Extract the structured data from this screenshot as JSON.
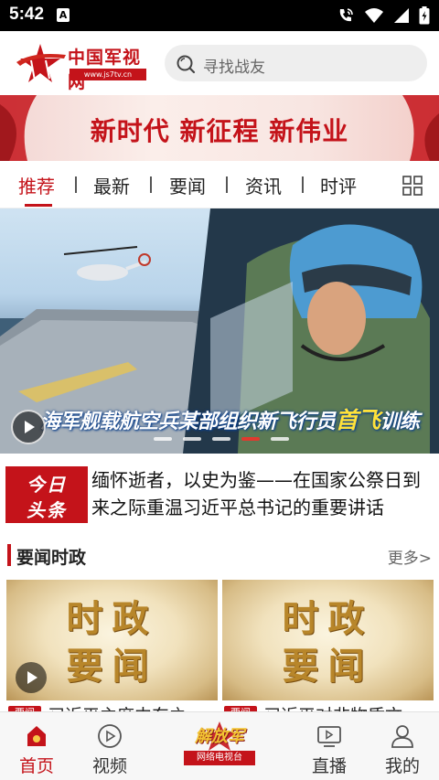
{
  "status_bar": {
    "time": "5:42",
    "notification": "A"
  },
  "header": {
    "logo_name": "中国军视网",
    "logo_url": "www.js7tv.cn",
    "search_placeholder": "寻找战友"
  },
  "banner": {
    "slogan": "新时代 新征程 新伟业"
  },
  "tabs": [
    {
      "label": "推荐",
      "active": true
    },
    {
      "label": "最新",
      "active": false
    },
    {
      "label": "要闻",
      "active": false
    },
    {
      "label": "资讯",
      "active": false
    },
    {
      "label": "时评",
      "active": false
    }
  ],
  "hero": {
    "caption_main": "海军舰载航空兵某部组织新飞行员",
    "caption_highlight": "首飞",
    "caption_end": "训练",
    "slide_count": 5,
    "active_slide": 4
  },
  "headline": {
    "badge_line1": "今日",
    "badge_line2": "头条",
    "text": "缅怀逝者，以史为鉴——在国家公祭日到来之际重温习近平总书记的重要讲话"
  },
  "section": {
    "title": "要闻时政",
    "more": "更多>"
  },
  "cards": [
    {
      "line1": "时政",
      "line2": "要闻",
      "tag": "要闻",
      "title": "习近平主席中东之"
    },
    {
      "line1": "时政",
      "line2": "要闻",
      "tag": "要闻",
      "title": "习近平对非物质文"
    }
  ],
  "bottom_nav": {
    "items": [
      {
        "label": "首页",
        "icon": "home-icon",
        "active": true
      },
      {
        "label": "视频",
        "icon": "play-circle-icon",
        "active": false
      },
      {
        "label": "直播",
        "icon": "tv-icon",
        "active": false
      },
      {
        "label": "我的",
        "icon": "user-icon",
        "active": false
      }
    ],
    "center_title": "解放军",
    "center_subtitle": "网络电视台"
  },
  "colors": {
    "accent": "#c4131a",
    "highlight": "#ffe23a"
  }
}
